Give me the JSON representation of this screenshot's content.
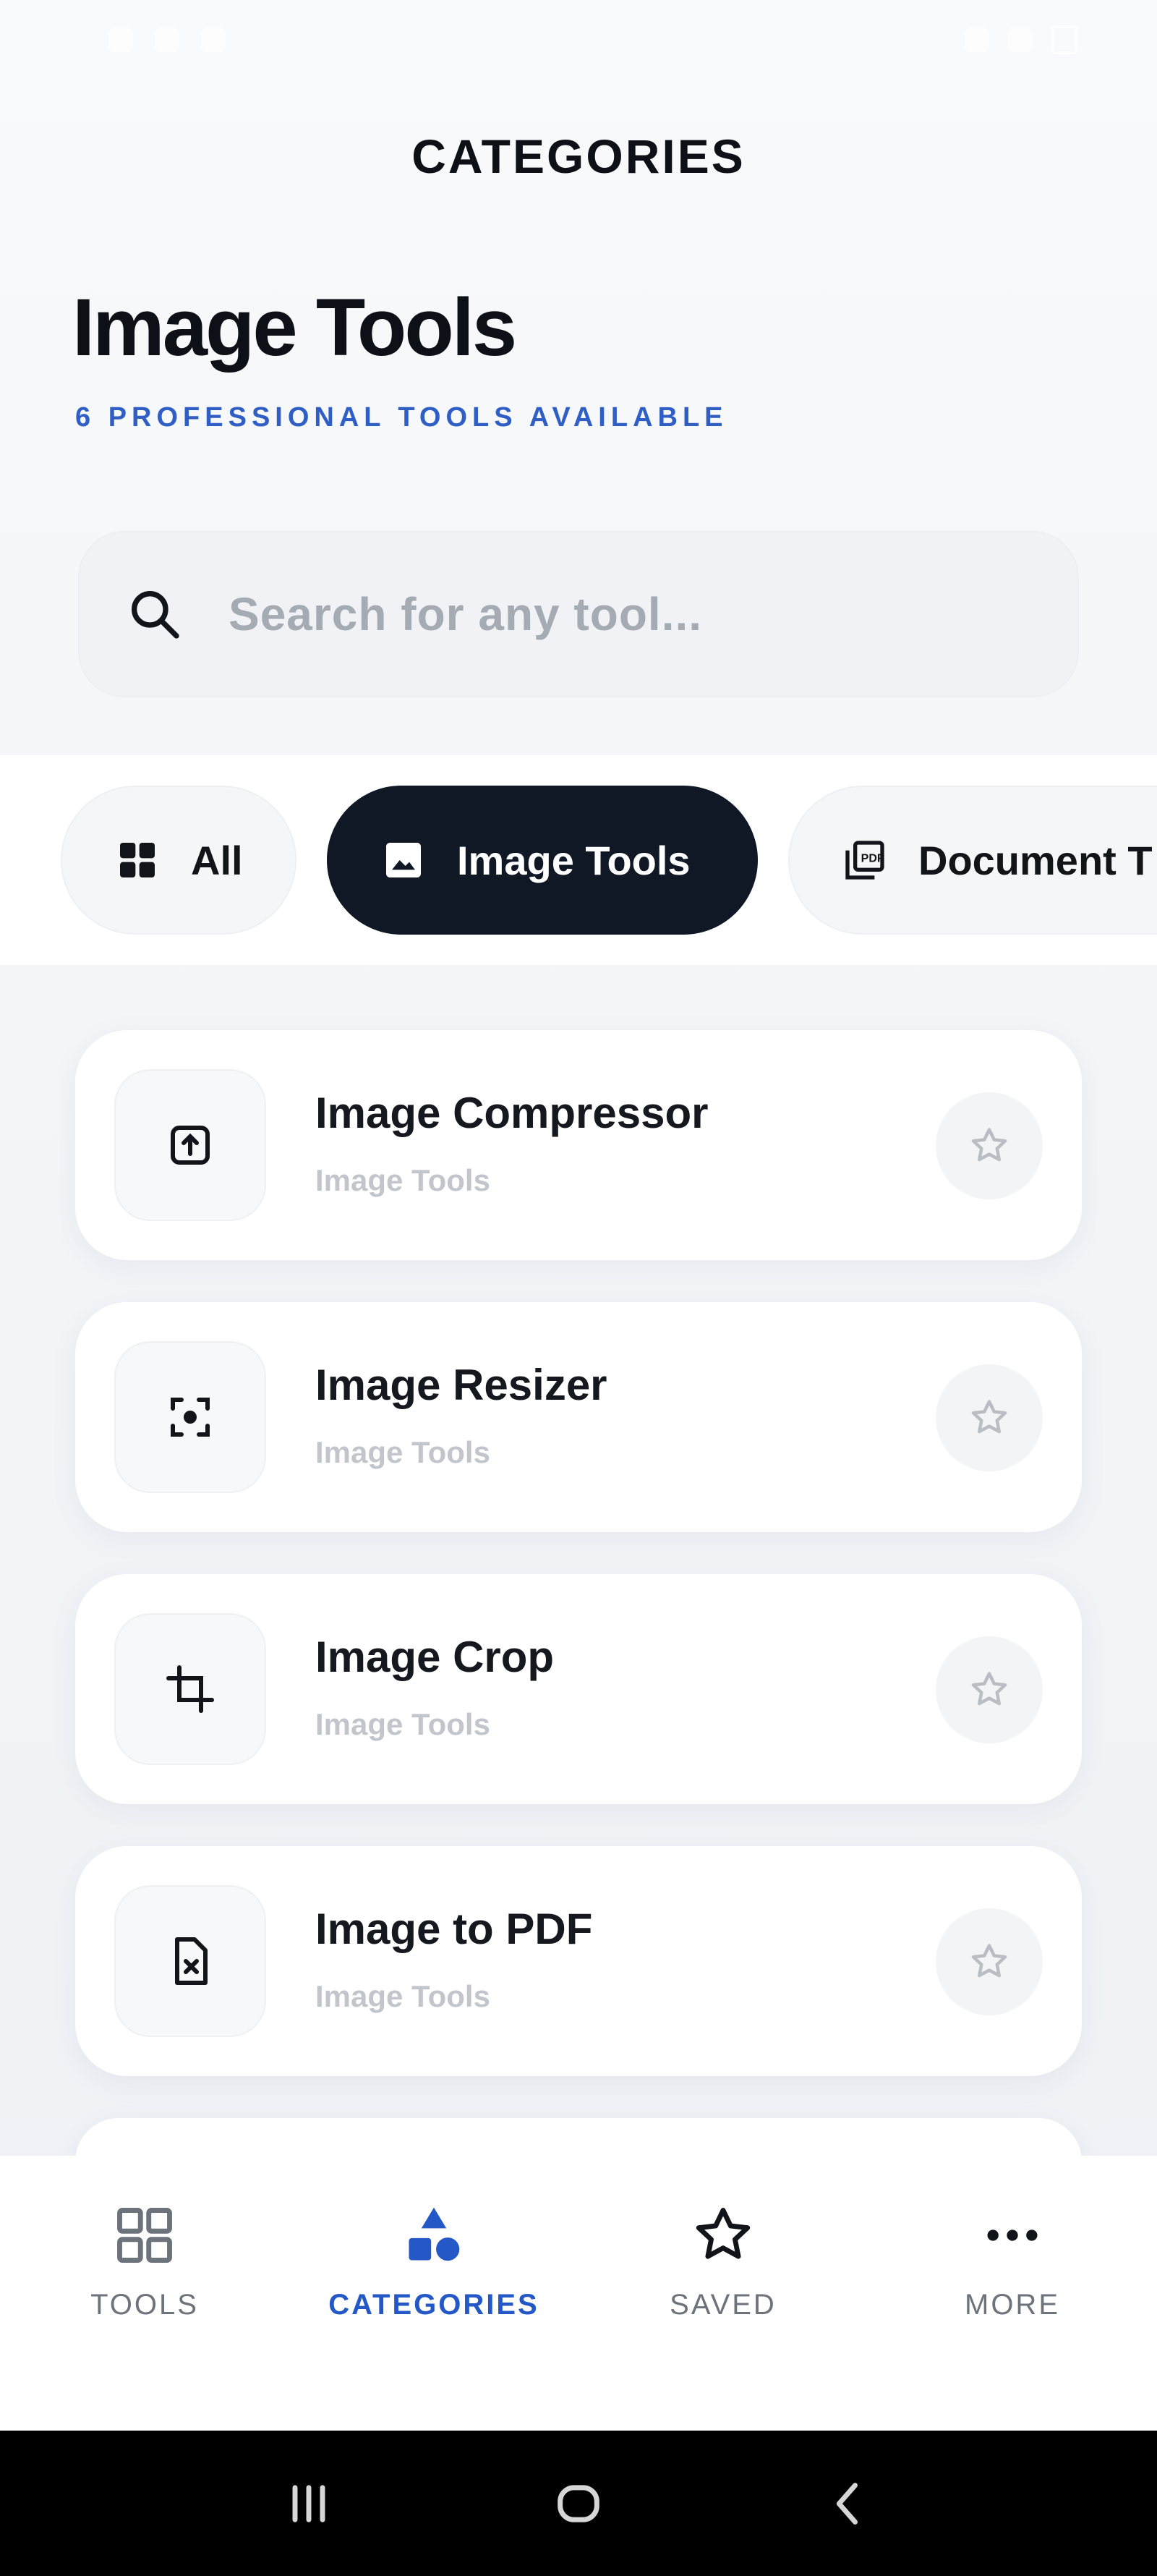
{
  "header": {
    "screen_title": "CATEGORIES",
    "category_title": "Image Tools",
    "subtitle": "6 PROFESSIONAL TOOLS AVAILABLE"
  },
  "search": {
    "placeholder": "Search for any tool...",
    "icon": "search-icon"
  },
  "chips": [
    {
      "label": "All",
      "icon": "grid-icon",
      "active": false
    },
    {
      "label": "Image Tools",
      "icon": "image-icon",
      "active": true
    },
    {
      "label": "Document T",
      "icon": "document-icon",
      "active": false
    }
  ],
  "tools": [
    {
      "name": "Image Compressor",
      "category": "Image Tools",
      "icon": "compress-icon"
    },
    {
      "name": "Image Resizer",
      "category": "Image Tools",
      "icon": "resize-icon"
    },
    {
      "name": "Image Crop",
      "category": "Image Tools",
      "icon": "crop-icon"
    },
    {
      "name": "Image to PDF",
      "category": "Image Tools",
      "icon": "pdf-file-icon"
    }
  ],
  "bottom_nav": [
    {
      "label": "TOOLS",
      "icon": "grid-outline-icon",
      "active": false
    },
    {
      "label": "CATEGORIES",
      "icon": "shapes-icon",
      "active": true
    },
    {
      "label": "SAVED",
      "icon": "star-outline-icon",
      "active": false
    },
    {
      "label": "MORE",
      "icon": "more-dots-icon",
      "active": false
    }
  ],
  "colors": {
    "accent": "#2458c7",
    "active_chip": "#101826",
    "text_primary": "#15191f",
    "text_muted": "#c2c6cc"
  }
}
